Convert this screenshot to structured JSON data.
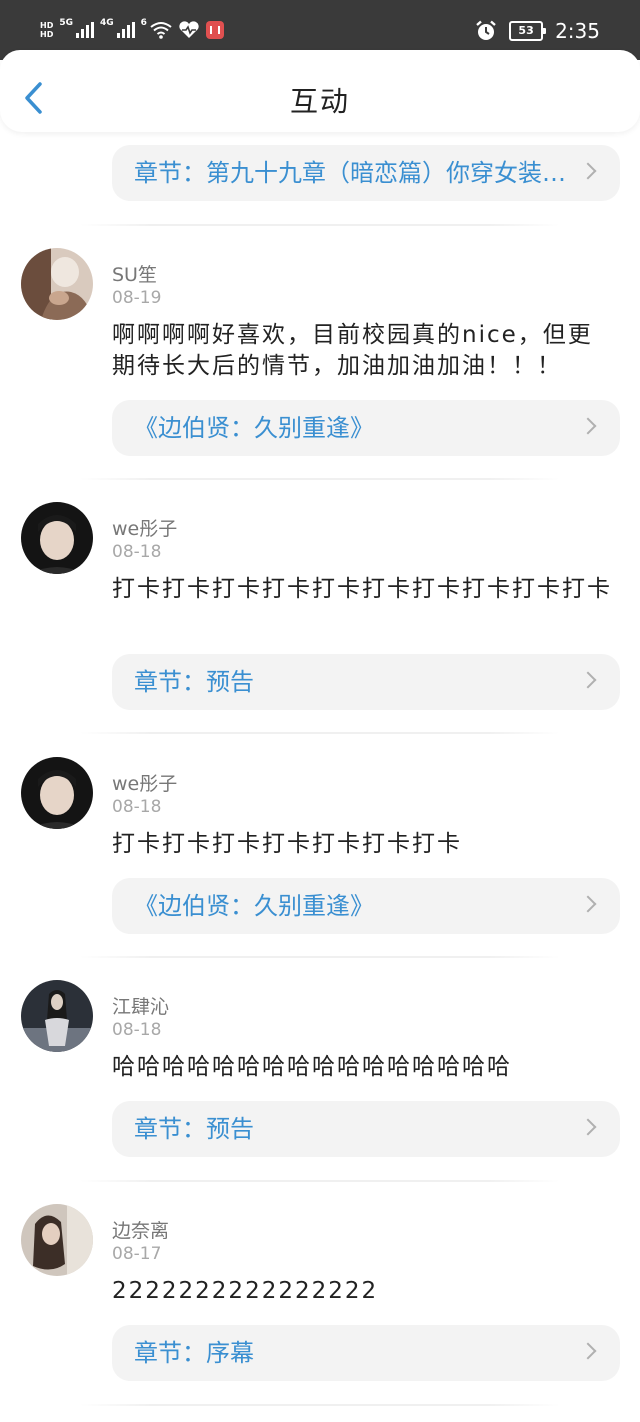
{
  "status_bar": {
    "hd1": "HD",
    "hd2": "HD",
    "net1": "5G",
    "net2": "4G",
    "wifi_label": "6",
    "battery": "53",
    "time": "2:35"
  },
  "header": {
    "title": "互动"
  },
  "top_chip": {
    "label": "章节：第九十九章（暗恋篇）你穿女装好看"
  },
  "comments": [
    {
      "username": "SU笙",
      "date": "08-19",
      "text": "啊啊啊啊好喜欢，目前校园真的nice，但更期待长大后的情节，加油加油加油！！！",
      "chip": "《边伯贤：久别重逢》"
    },
    {
      "username": "we彤子",
      "date": "08-18",
      "text": "打卡打卡打卡打卡打卡打卡打卡打卡打卡打卡",
      "chip": "章节：预告"
    },
    {
      "username": "we彤子",
      "date": "08-18",
      "text": "打卡打卡打卡打卡打卡打卡打卡",
      "chip": "《边伯贤：久别重逢》"
    },
    {
      "username": "江肆沁",
      "date": "08-18",
      "text": "哈哈哈哈哈哈哈哈哈哈哈哈哈哈哈哈",
      "chip": "章节：预告"
    },
    {
      "username": "边奈离",
      "date": "08-17",
      "text": "2222222222222222",
      "chip": "章节：序幕"
    }
  ]
}
